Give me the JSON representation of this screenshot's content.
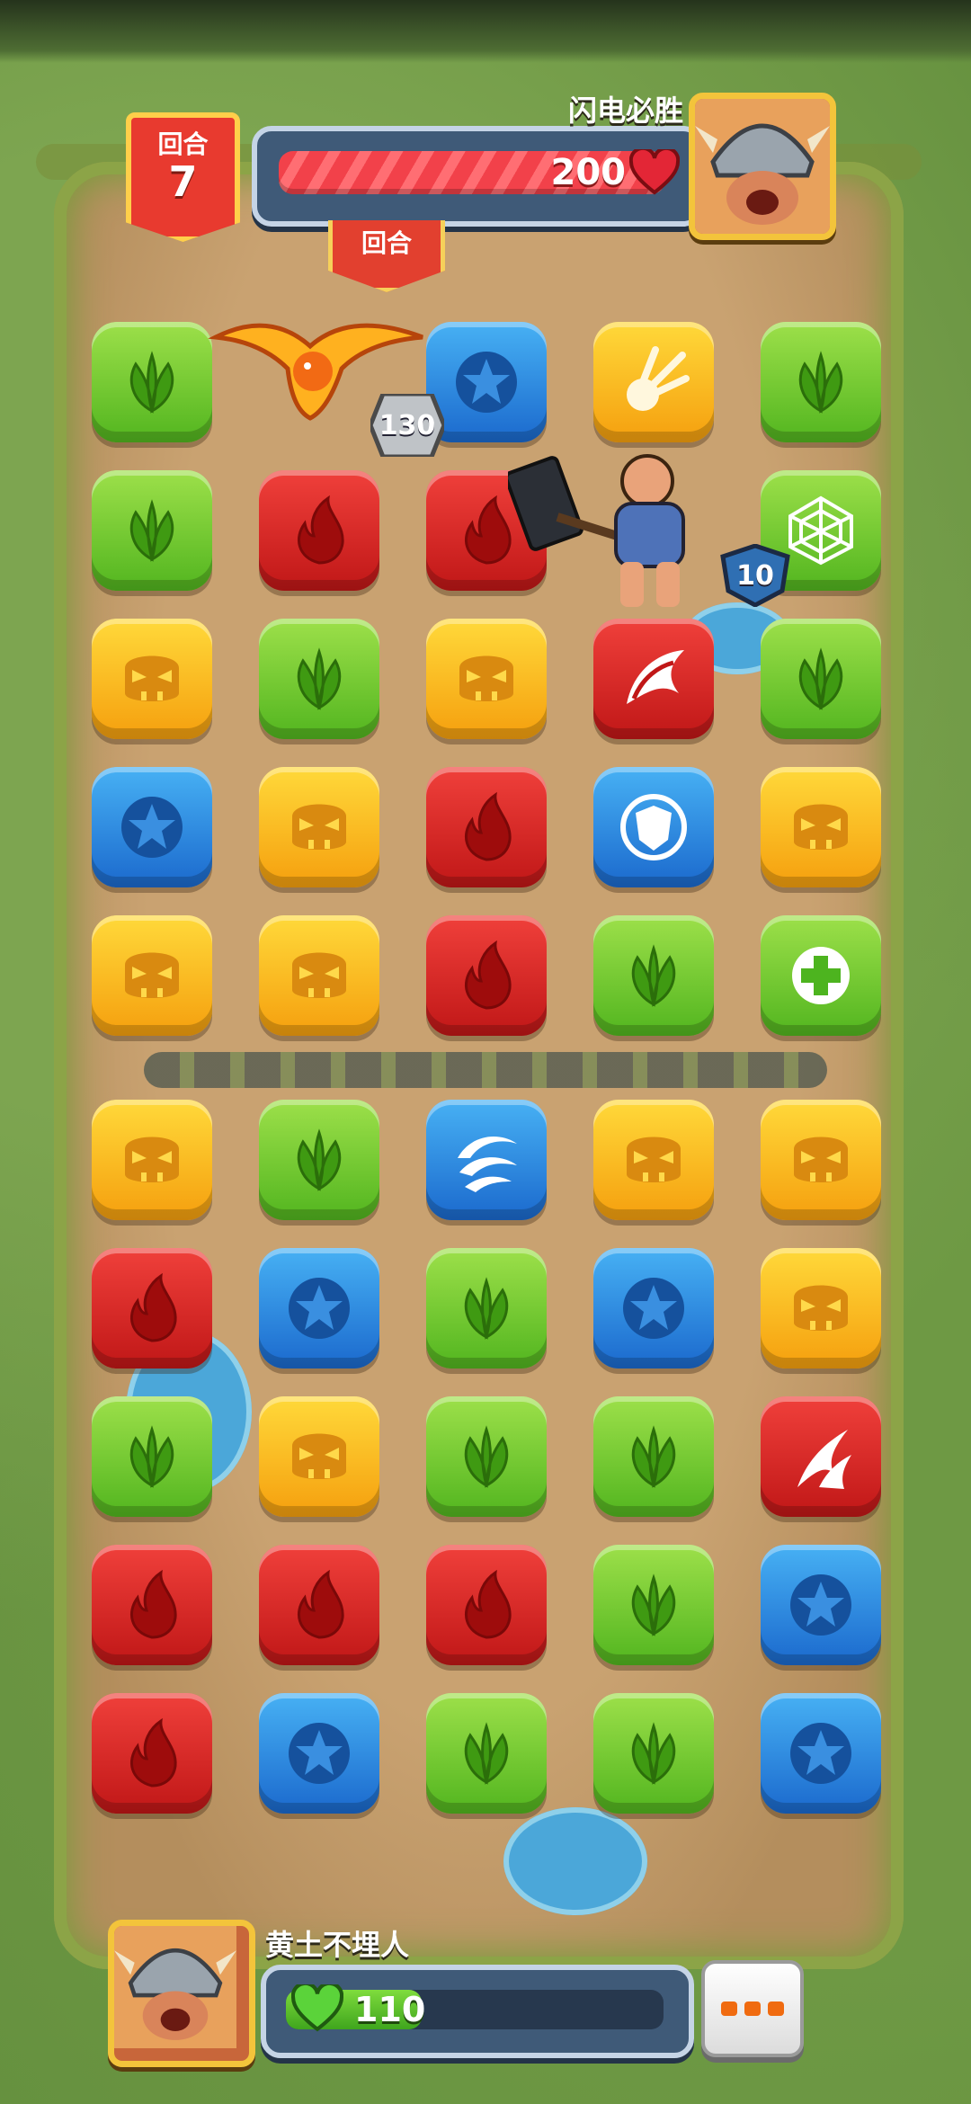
{
  "opponent": {
    "name": "闪电必胜",
    "hp": "200",
    "avatar": "viking-helmet-warrior"
  },
  "round": {
    "label": "回合",
    "number": "7",
    "tab_label": "回合"
  },
  "units": {
    "dragon": {
      "icon": "fire-dragon",
      "level": "130"
    },
    "warrior": {
      "icon": "hammer-warrior",
      "level": "10"
    }
  },
  "board": {
    "rows": [
      [
        "leaf",
        "empty",
        "star",
        "explosion",
        "leaf"
      ],
      [
        "leaf",
        "fire",
        "fire",
        "empty",
        "web"
      ],
      [
        "skull",
        "leaf",
        "skull",
        "wing-strike",
        "leaf"
      ],
      [
        "star",
        "skull",
        "fire",
        "shield",
        "skull"
      ],
      [
        "skull",
        "skull",
        "fire",
        "leaf",
        "heal-plus"
      ],
      [
        "skull",
        "leaf",
        "whirlwind",
        "skull",
        "skull"
      ],
      [
        "fire",
        "star",
        "leaf",
        "star",
        "skull"
      ],
      [
        "leaf",
        "skull",
        "leaf",
        "leaf",
        "claw-slash"
      ],
      [
        "fire",
        "fire",
        "fire",
        "leaf",
        "star"
      ],
      [
        "fire",
        "star",
        "leaf",
        "leaf",
        "star"
      ]
    ],
    "colors": {
      "green": "#52b51f",
      "red": "#c01717",
      "yellow": "#f59f0e",
      "blue": "#1b69cd"
    }
  },
  "player": {
    "name": "黄土不埋人",
    "hp": "110",
    "hp_fraction": 0.36,
    "avatar": "viking-helmet-warrior"
  },
  "menu": {
    "more_icon": "more-dots-icon"
  }
}
